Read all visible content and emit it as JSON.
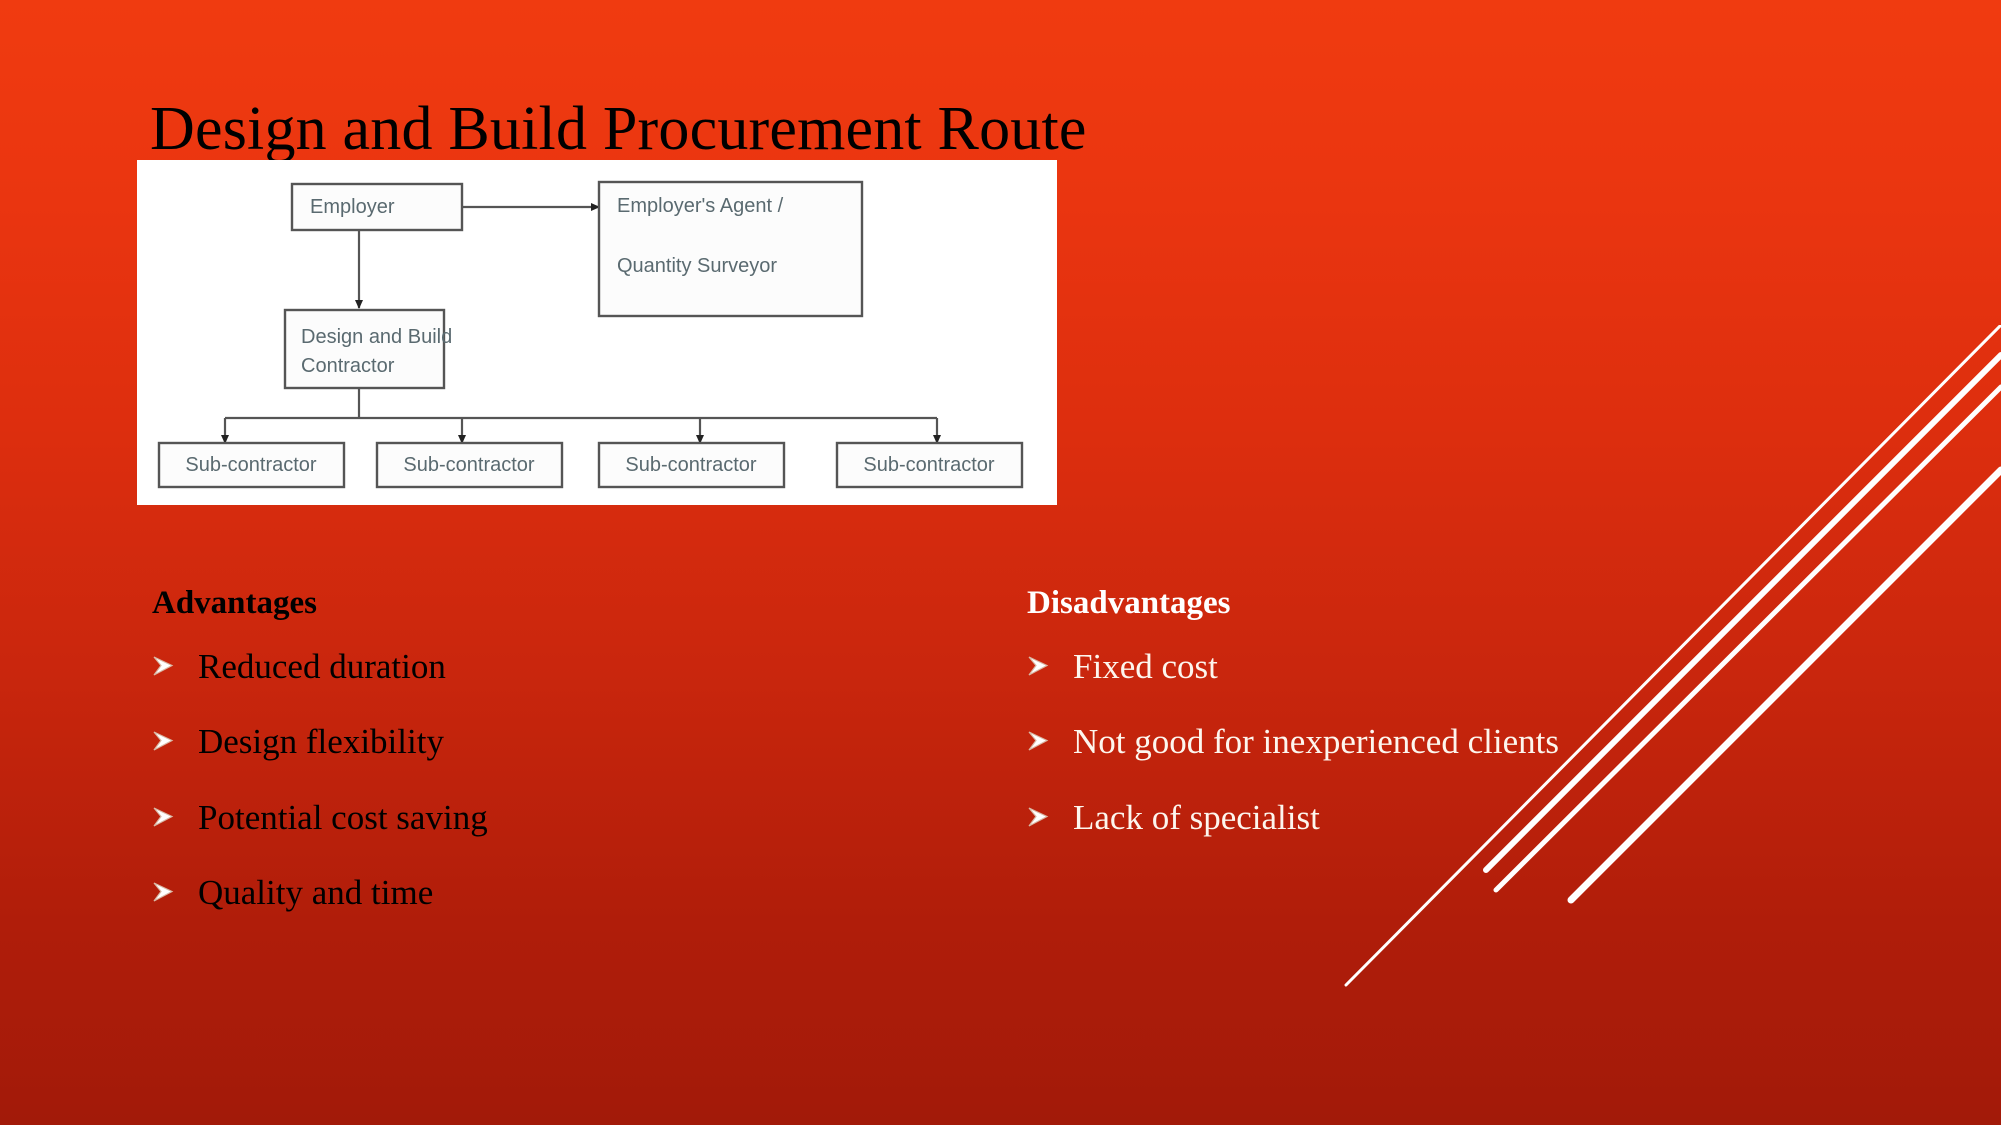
{
  "slide": {
    "title": "Design and Build Procurement Route",
    "background": {
      "top_color": "#f03b10",
      "bottom_color": "#a21a09"
    },
    "decoration": {
      "name": "diagonal-streaks",
      "color": "#ffffff",
      "line_count": 4
    }
  },
  "diagram": {
    "name": "design-and-build-org-chart",
    "background": "#ffffff",
    "box_text_color": "#5a6a70",
    "nodes": {
      "employer": "Employer",
      "agent_line1": "Employer's Agent /",
      "agent_line2": "Quantity Surveyor",
      "contractor_line1": "Design and Build",
      "contractor_line2": "Contractor",
      "subcontractors": [
        "Sub-contractor",
        "Sub-contractor",
        "Sub-contractor",
        "Sub-contractor"
      ]
    }
  },
  "advantages": {
    "heading": "Advantages",
    "text_color": "#000000",
    "items": [
      "Reduced duration",
      "Design flexibility",
      "Potential cost saving",
      "Quality and time"
    ]
  },
  "disadvantages": {
    "heading": "Disadvantages",
    "text_color": "#ffffff",
    "items": [
      "Fixed cost",
      "Not good for inexperienced clients",
      "Lack of specialist"
    ]
  }
}
